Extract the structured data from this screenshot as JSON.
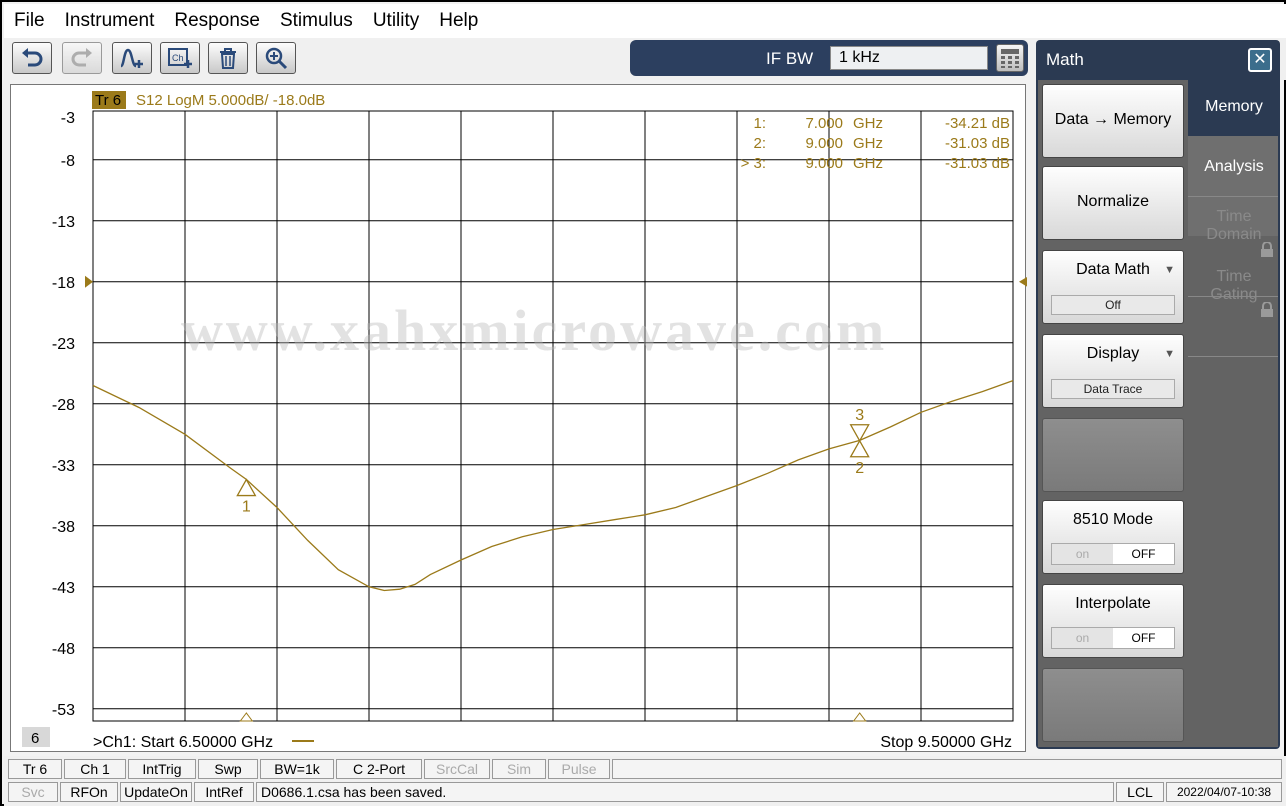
{
  "menu": [
    "File",
    "Instrument",
    "Response",
    "Stimulus",
    "Utility",
    "Help"
  ],
  "toolbar": {
    "icons": [
      "undo-icon",
      "redo-icon",
      "add-trace-icon",
      "add-channel-icon",
      "delete-icon",
      "zoom-icon"
    ]
  },
  "ifbw": {
    "label": "IF BW",
    "value": "1 kHz"
  },
  "trace": {
    "badge": "Tr 6",
    "header": "S12 LogM 5.000dB/  -18.0dB",
    "color": "#9b7a1a",
    "ref_value": -18,
    "channel_number": "6",
    "start_label": ">Ch1:  Start   6.50000 GHz",
    "stop_label": "Stop  9.50000 GHz"
  },
  "markers": [
    {
      "num": "1:",
      "freq": "7.000",
      "unit": "GHz",
      "val": "-34.21 dB"
    },
    {
      "num": "2:",
      "freq": "9.000",
      "unit": "GHz",
      "val": "-31.03 dB"
    },
    {
      "num": "> 3:",
      "freq": "9.000",
      "unit": "GHz",
      "val": "-31.03 dB"
    }
  ],
  "marker_points": [
    {
      "label": "1",
      "x": 7.0,
      "y": -34.21,
      "dir": "up"
    },
    {
      "label": "2",
      "x": 9.0,
      "y": -31.03,
      "dir": "up"
    },
    {
      "label": "3",
      "x": 9.0,
      "y": -31.03,
      "dir": "down"
    }
  ],
  "watermark": "www.xahxmicrowave.com",
  "chart_data": {
    "type": "line",
    "title": "S12 LogM 5.000dB/  -18.0dB",
    "xlabel": "",
    "ylabel": "",
    "xlim": [
      6.5,
      9.5
    ],
    "ylim": [
      -54,
      -4
    ],
    "y_ticks": [
      "-3",
      "-8",
      "-13",
      "-18",
      "-23",
      "-28",
      "-33",
      "-38",
      "-43",
      "-48",
      "-53"
    ],
    "grid": true,
    "series": [
      {
        "x": [
          6.5,
          6.65,
          6.8,
          6.95,
          7.0,
          7.1,
          7.2,
          7.3,
          7.4,
          7.45,
          7.5,
          7.55,
          7.6,
          7.7,
          7.8,
          7.9,
          8.0,
          8.1,
          8.2,
          8.3,
          8.4,
          8.5,
          8.6,
          8.7,
          8.8,
          8.9,
          9.0,
          9.1,
          9.2,
          9.3,
          9.4,
          9.5
        ],
        "y": [
          -26.5,
          -28.3,
          -30.5,
          -33.3,
          -34.2,
          -36.5,
          -39.2,
          -41.6,
          -43.0,
          -43.3,
          -43.2,
          -42.8,
          -42.0,
          -40.8,
          -39.7,
          -38.9,
          -38.3,
          -37.9,
          -37.5,
          -37.1,
          -36.5,
          -35.6,
          -34.7,
          -33.7,
          -32.6,
          -31.7,
          -31.0,
          -29.9,
          -28.7,
          -27.8,
          -27.0,
          -26.1
        ]
      }
    ]
  },
  "softpanel": {
    "title": "Math",
    "close": "✕",
    "keys": [
      {
        "label": "Data → Memory"
      },
      {
        "label": "Normalize"
      },
      {
        "label": "Data Math",
        "sub": "Off"
      },
      {
        "label": "Display",
        "sub": "Data Trace"
      },
      {
        "label": "8510 Mode",
        "on": "on",
        "off": "OFF"
      },
      {
        "label": "Interpolate",
        "on": "on",
        "off": "OFF"
      }
    ],
    "tabs": [
      "Memory",
      "Analysis",
      "Time Domain",
      "Time Gating"
    ]
  },
  "status1": [
    "Tr 6",
    "Ch 1",
    "IntTrig",
    "Swp",
    "BW=1k",
    "C  2-Port",
    "SrcCal",
    "Sim",
    "Pulse"
  ],
  "status2": {
    "items": [
      "Svc",
      "RFOn",
      "UpdateOn",
      "IntRef"
    ],
    "message": "D0686.1.csa has been saved.",
    "lcl": "LCL",
    "datetime": "2022/04/07-10:38"
  }
}
